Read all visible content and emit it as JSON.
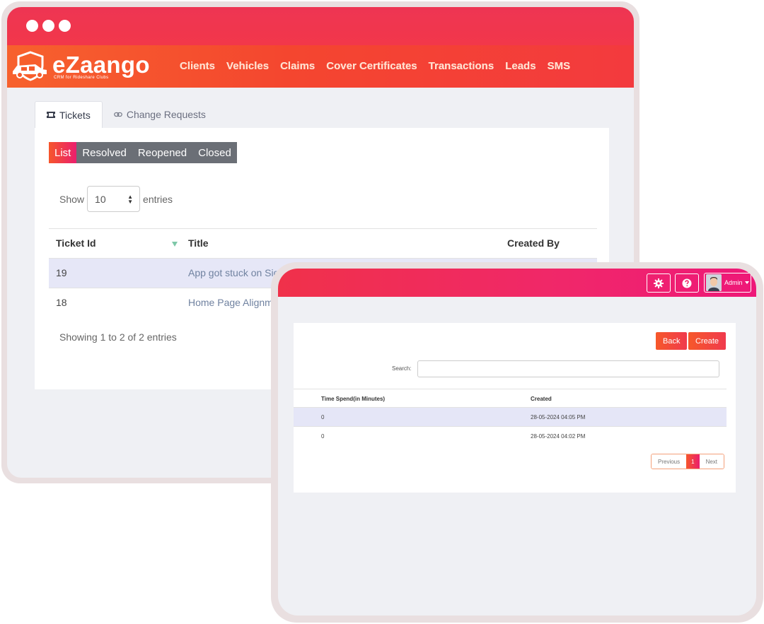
{
  "app": {
    "brand": "eZaango",
    "tagline": "CRM for Rideshare Clubs",
    "accent": "#f4462f",
    "accent_pink": "#ea1e6e"
  },
  "nav": {
    "links": [
      "Clients",
      "Vehicles",
      "Claims",
      "Cover Certificates",
      "Transactions",
      "Leads",
      "SMS"
    ]
  },
  "tabs": [
    {
      "label": "Tickets",
      "icon": "ticket-icon",
      "active": true
    },
    {
      "label": "Change Requests",
      "icon": "link-icon",
      "active": false
    }
  ],
  "filter_buttons": [
    {
      "label": "List",
      "active": true
    },
    {
      "label": "Resolved",
      "active": false
    },
    {
      "label": "Reopened",
      "active": false
    },
    {
      "label": "Closed",
      "active": false
    }
  ],
  "entries": {
    "show_label": "Show",
    "value": "10",
    "entries_label": "entries"
  },
  "tickets_table": {
    "columns": [
      "Ticket Id",
      "Title",
      "Created By"
    ],
    "rows": [
      {
        "id": "19",
        "title": "App got stuck on Sign"
      },
      {
        "id": "18",
        "title": "Home Page Alignme"
      }
    ],
    "footer": "Showing 1 to 2 of 2 entries"
  },
  "detail_window": {
    "user": "Admin",
    "back_label": "Back",
    "create_label": "Create",
    "search_label": "Search:",
    "columns": [
      "Time Spend(in Minutes)",
      "Created"
    ],
    "rows": [
      {
        "time": "0",
        "created": "28-05-2024 04:05 PM"
      },
      {
        "time": "0",
        "created": "28-05-2024 04:02 PM"
      }
    ],
    "pager": {
      "prev": "Previous",
      "page": "1",
      "next": "Next"
    }
  }
}
